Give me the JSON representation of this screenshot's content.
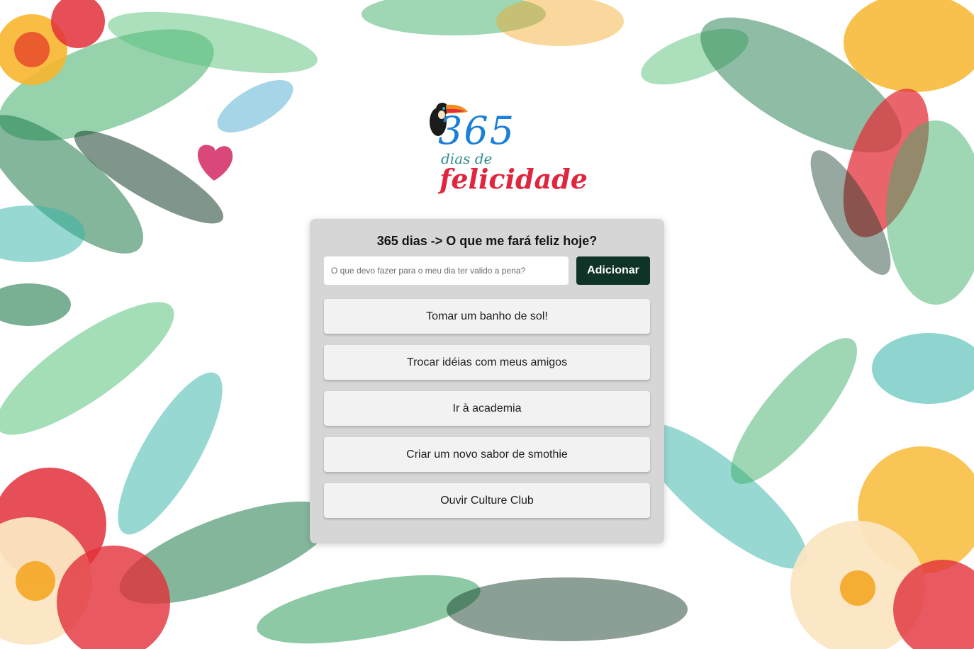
{
  "logo": {
    "number": "365",
    "line1": "dias de",
    "line2": "felicidade"
  },
  "card": {
    "title": "365 dias -> O que me fará feliz hoje?",
    "input": {
      "value": "",
      "placeholder": "O que devo fazer para o meu dia ter valido a pena?"
    },
    "add_button_label": "Adicionar",
    "tasks": [
      {
        "label": "Tomar um banho de sol!"
      },
      {
        "label": "Trocar idéias com meus amigos"
      },
      {
        "label": "Ir à academia"
      },
      {
        "label": "Criar um novo sabor de smothie"
      },
      {
        "label": "Ouvir Culture Club"
      }
    ]
  },
  "colors": {
    "accent_button": "#0f3326",
    "card_background": "#d6d6d6",
    "task_background": "#f2f2f2",
    "logo_blue": "#1a7fd6",
    "logo_red": "#e0263f"
  },
  "icons": [
    "toucan-icon",
    "heart-leaf-icon",
    "hibiscus-flower-icon",
    "palm-leaf-icon"
  ]
}
